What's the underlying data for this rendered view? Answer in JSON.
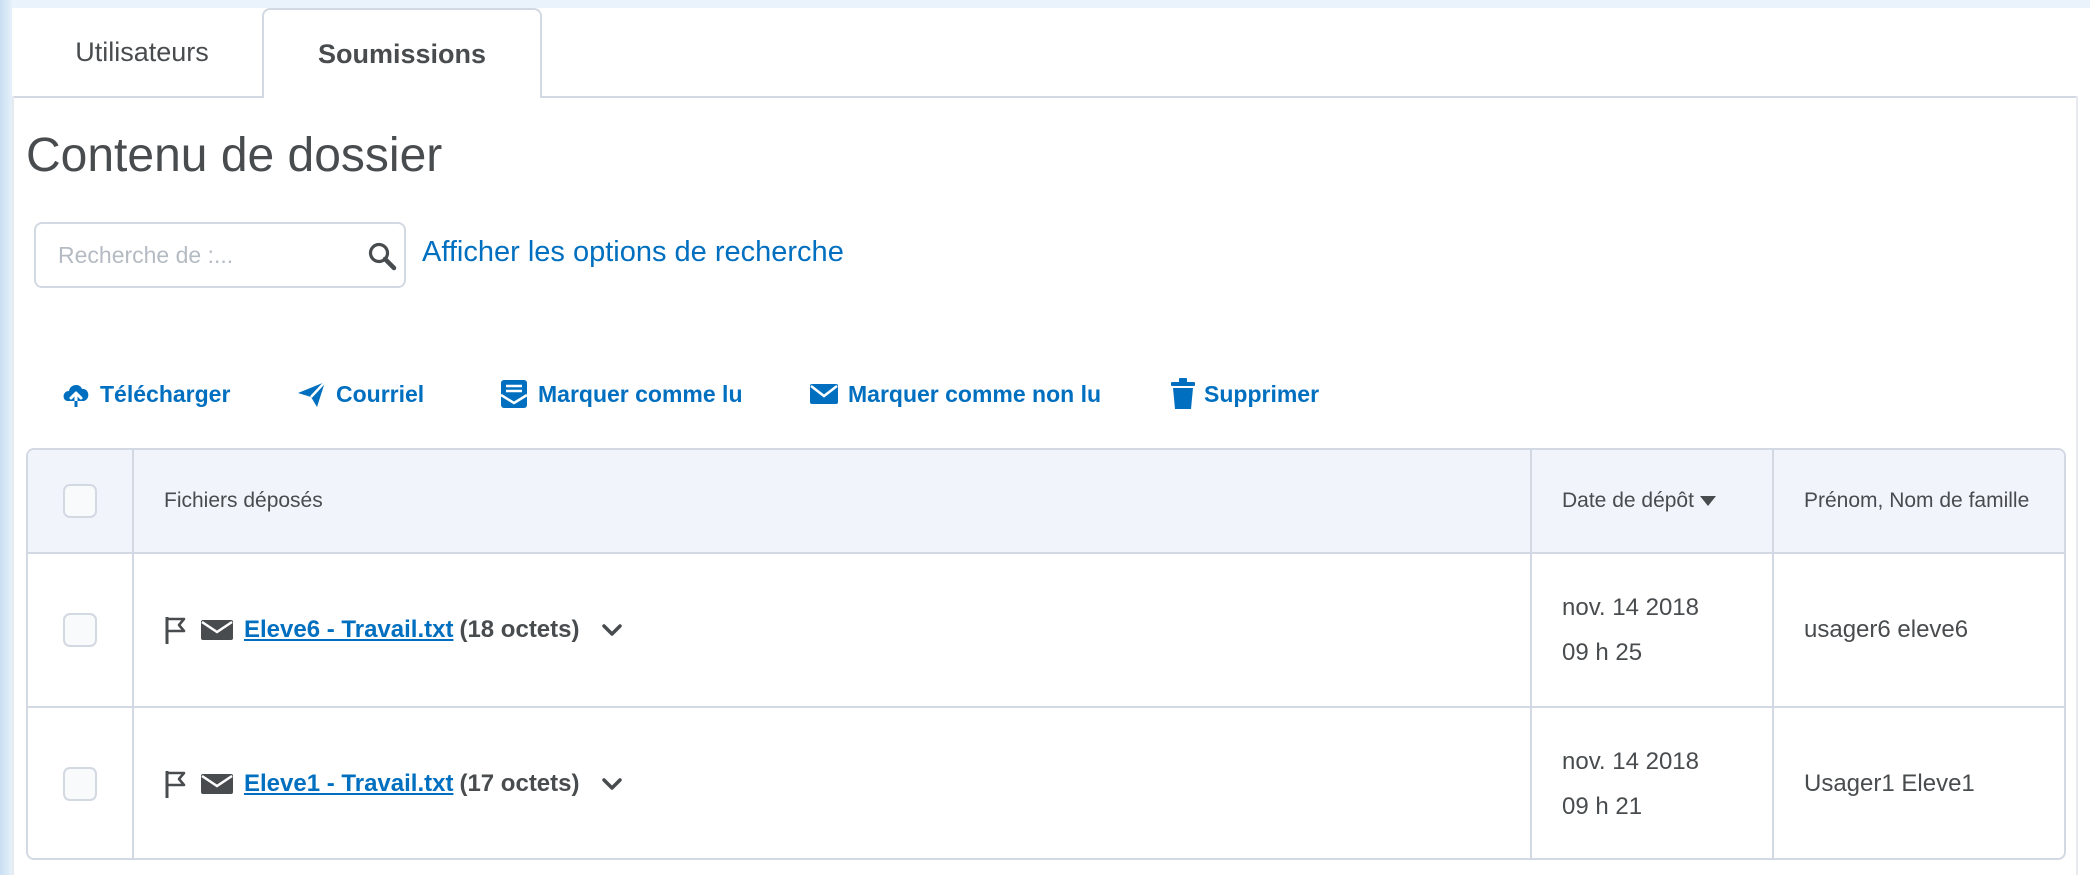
{
  "tabs": [
    {
      "label": "Utilisateurs",
      "active": false
    },
    {
      "label": "Soumissions",
      "active": true
    }
  ],
  "page_title": "Contenu de dossier",
  "search": {
    "placeholder": "Recherche de :...",
    "value": "",
    "options_link": "Afficher les options de recherche"
  },
  "toolbar": {
    "download": "Télécharger",
    "email": "Courriel",
    "mark_read": "Marquer comme lu",
    "mark_unread": "Marquer comme non lu",
    "delete": "Supprimer"
  },
  "table": {
    "headers": {
      "files": "Fichiers déposés",
      "date": "Date de dépôt",
      "name": "Prénom, Nom de famille"
    },
    "rows": [
      {
        "file": "Eleve6 - Travail.txt",
        "size": "(18 octets)",
        "date": "nov. 14 2018",
        "time": "09 h 25",
        "name": "usager6 eleve6"
      },
      {
        "file": "Eleve1 - Travail.txt",
        "size": "(17 octets)",
        "date": "nov. 14 2018",
        "time": "09 h 21",
        "name": "Usager1 Eleve1"
      }
    ]
  },
  "colors": {
    "link": "#006fbf",
    "text": "#494c4e",
    "border": "#d3d9e3",
    "header_bg": "#f1f5fb"
  }
}
